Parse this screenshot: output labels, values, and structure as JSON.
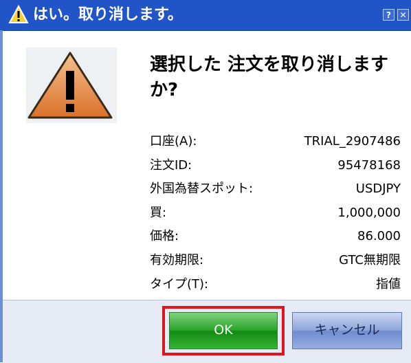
{
  "window": {
    "title": "はい。取り消します。",
    "help_glyph": "?",
    "close_glyph": "✕"
  },
  "message": {
    "heading": "選択した 注文を取り消しますか?"
  },
  "details": [
    {
      "label": "口座(A):",
      "value": "TRIAL_2907486"
    },
    {
      "label": "注文ID:",
      "value": "95478168"
    },
    {
      "label": "外国為替スポット:",
      "value": "USDJPY"
    },
    {
      "label": "買:",
      "value": "1,000,000"
    },
    {
      "label": "価格:",
      "value": "86.000"
    },
    {
      "label": "有効期限:",
      "value": "GTC無期限"
    },
    {
      "label": "タイプ(T):",
      "value": "指値"
    }
  ],
  "buttons": {
    "ok_label": "OK",
    "cancel_label": "キャンセル"
  },
  "colors": {
    "titlebar": "#2154c6",
    "ok_button": "#2aa52a",
    "highlight": "#e0141e",
    "warning_fill": "#e58a3e"
  }
}
